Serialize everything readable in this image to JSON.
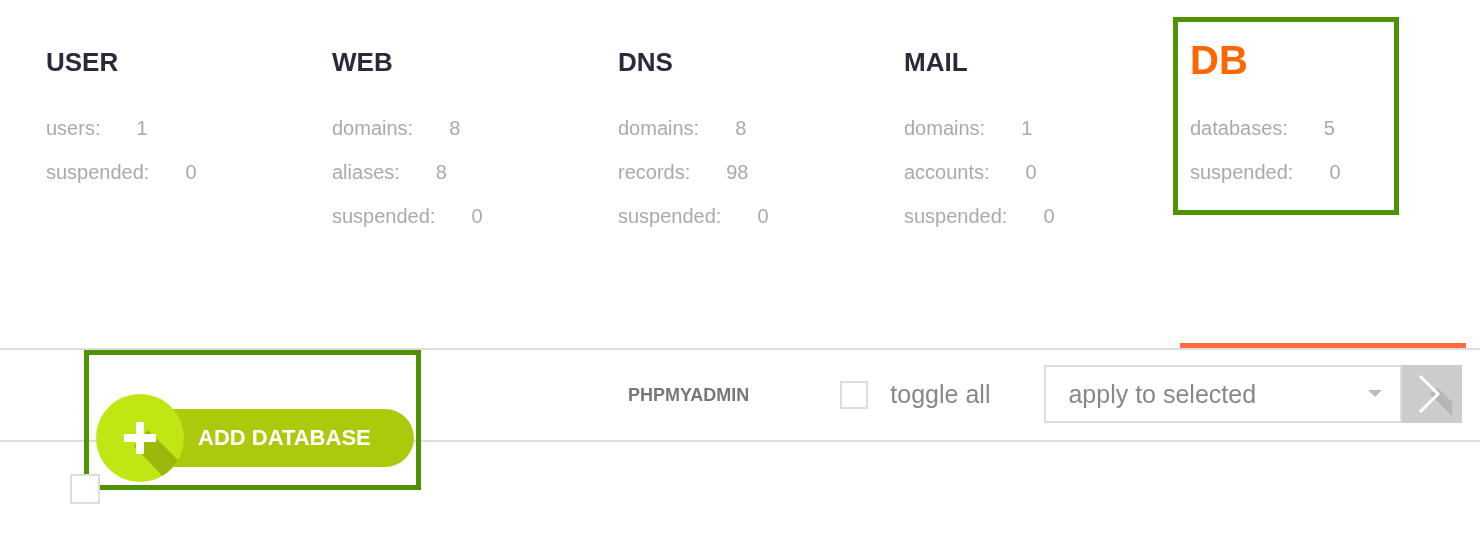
{
  "stats": [
    {
      "title": "USER",
      "selected": false,
      "rows": [
        {
          "label": "users:",
          "value": "1"
        },
        {
          "label": "suspended:",
          "value": "0"
        }
      ]
    },
    {
      "title": "WEB",
      "selected": false,
      "rows": [
        {
          "label": "domains:",
          "value": "8"
        },
        {
          "label": "aliases:",
          "value": "8"
        },
        {
          "label": "suspended:",
          "value": "0"
        }
      ]
    },
    {
      "title": "DNS",
      "selected": false,
      "rows": [
        {
          "label": "domains:",
          "value": "8"
        },
        {
          "label": "records:",
          "value": "98"
        },
        {
          "label": "suspended:",
          "value": "0"
        }
      ]
    },
    {
      "title": "MAIL",
      "selected": false,
      "rows": [
        {
          "label": "domains:",
          "value": "1"
        },
        {
          "label": "accounts:",
          "value": "0"
        },
        {
          "label": "suspended:",
          "value": "0"
        }
      ]
    },
    {
      "title": "DB",
      "selected": true,
      "highlighted": true,
      "rows": [
        {
          "label": "databases:",
          "value": "5"
        },
        {
          "label": "suspended:",
          "value": "0"
        }
      ]
    }
  ],
  "toolbar": {
    "add_button": {
      "label": "ADD DATABASE",
      "highlighted": true
    },
    "link": "PHPMYADMIN",
    "toggle_all": {
      "label": "toggle all",
      "checked": false
    },
    "action_select": {
      "value": "apply to selected"
    }
  },
  "list": {
    "select_checkbox": {
      "checked": false
    }
  }
}
